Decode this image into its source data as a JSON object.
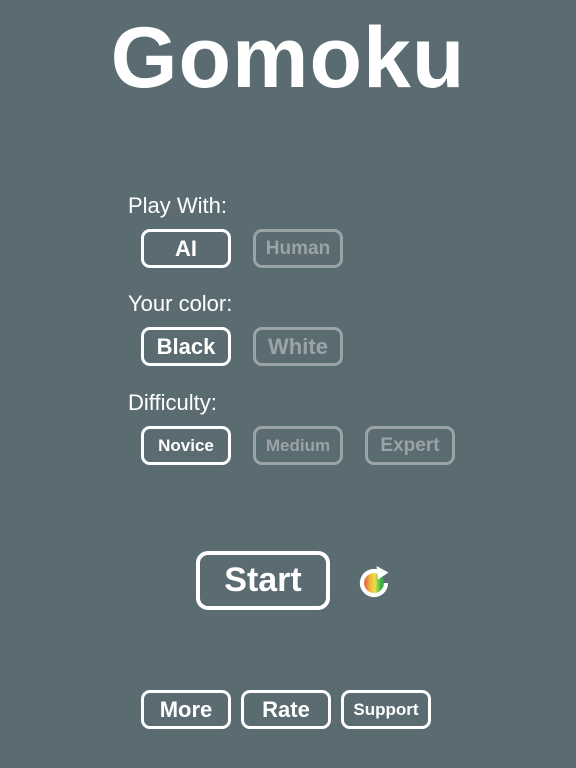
{
  "app": {
    "title": "Gomoku"
  },
  "play_with": {
    "label": "Play With:",
    "options": [
      "AI",
      "Human"
    ],
    "selected": "AI"
  },
  "your_color": {
    "label": "Your color:",
    "options": [
      "Black",
      "White"
    ],
    "selected": "Black"
  },
  "difficulty": {
    "label": "Difficulty:",
    "options": [
      "Novice",
      "Medium",
      "Expert"
    ],
    "selected": "Novice"
  },
  "actions": {
    "start_label": "Start",
    "cycle_icon": "refresh-color-icon"
  },
  "footer": {
    "more_label": "More",
    "rate_label": "Rate",
    "support_label": "Support"
  },
  "colors": {
    "background": "#5a6b72",
    "active": "#ffffff",
    "inactive": "#9aa3a6"
  }
}
